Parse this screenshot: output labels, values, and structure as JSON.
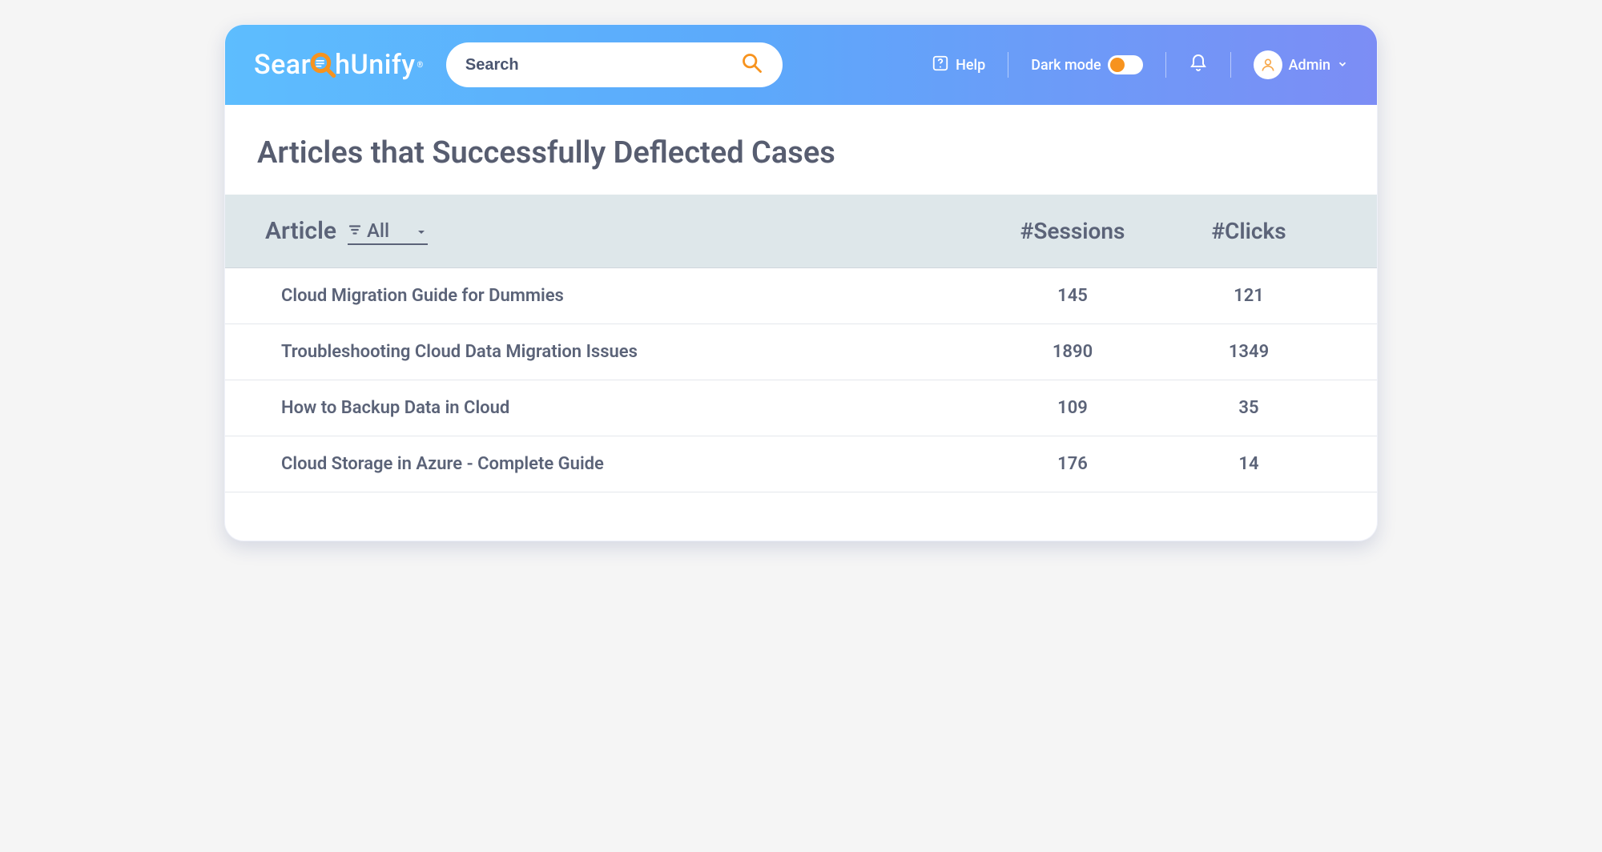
{
  "header": {
    "logo_prefix": "Sear",
    "logo_suffix": "hUnify",
    "search_placeholder": "Search",
    "help_label": "Help",
    "darkmode_label": "Dark mode",
    "user_label": "Admin"
  },
  "page": {
    "title": "Articles that Successfully Deflected Cases"
  },
  "table": {
    "columns": {
      "article": "Article",
      "filter_value": "All",
      "sessions": "#Sessions",
      "clicks": "#Clicks"
    },
    "rows": [
      {
        "article": "Cloud Migration Guide for Dummies",
        "sessions": "145",
        "clicks": "121"
      },
      {
        "article": "Troubleshooting Cloud Data Migration Issues",
        "sessions": "1890",
        "clicks": "1349"
      },
      {
        "article": "How to Backup Data in Cloud",
        "sessions": "109",
        "clicks": "35"
      },
      {
        "article": "Cloud Storage in Azure - Complete Guide",
        "sessions": "176",
        "clicks": "14"
      }
    ]
  }
}
